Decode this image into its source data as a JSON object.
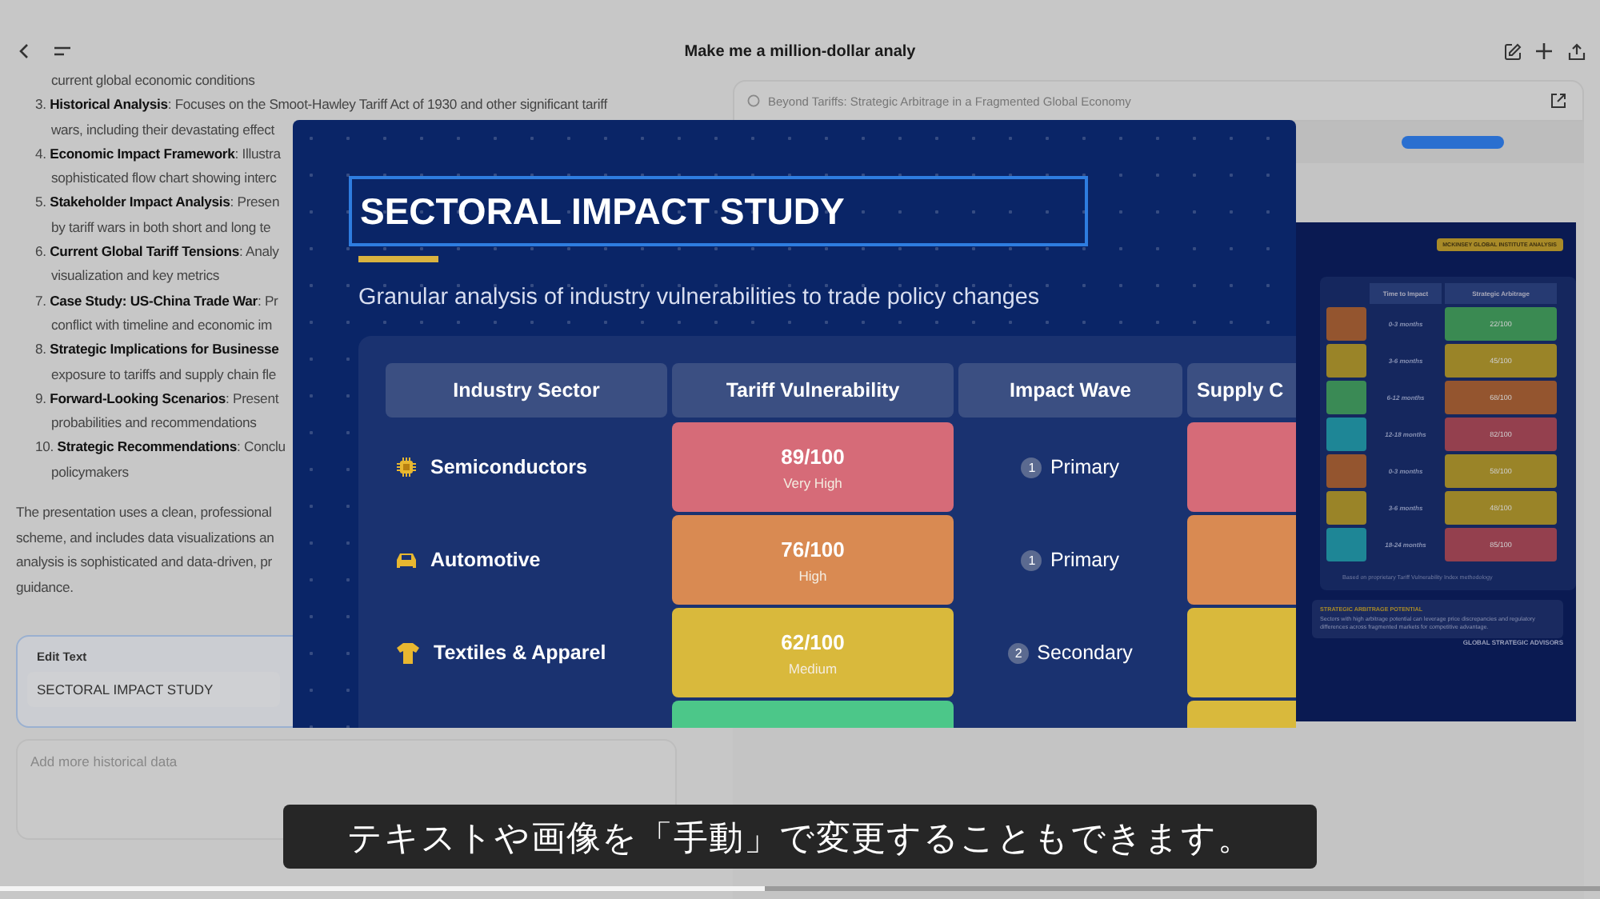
{
  "header": {
    "title": "Make me a million-dollar analy"
  },
  "chat": {
    "lines": [
      {
        "kind": "cont",
        "text": "current global economic conditions"
      },
      {
        "kind": "item",
        "text": "3. **Historical Analysis**: Focuses on the Smoot-Hawley Tariff Act of 1930 and other significant tariff"
      },
      {
        "kind": "cont",
        "text": "wars, including their devastating effect"
      },
      {
        "kind": "item",
        "text": "4. **Economic Impact Framework**: Illustra"
      },
      {
        "kind": "cont",
        "text": "sophisticated flow chart showing interc"
      },
      {
        "kind": "item",
        "text": "5. **Stakeholder Impact Analysis**: Presen"
      },
      {
        "kind": "cont",
        "text": "by tariff wars in both short and long te"
      },
      {
        "kind": "item",
        "text": "6. **Current Global Tariff Tensions**: Analy"
      },
      {
        "kind": "cont",
        "text": "visualization and key metrics"
      },
      {
        "kind": "item",
        "text": "7. **Case Study: US-China Trade War**: Pr"
      },
      {
        "kind": "cont",
        "text": "conflict with timeline and economic im"
      },
      {
        "kind": "item",
        "text": "8. **Strategic Implications for Businesse**"
      },
      {
        "kind": "cont",
        "text": "exposure to tariffs and supply chain fle"
      },
      {
        "kind": "item",
        "text": "9. **Forward-Looking Scenarios**: Present"
      },
      {
        "kind": "cont",
        "text": "probabilities and recommendations"
      },
      {
        "kind": "item",
        "text": "10. **Strategic Recommendations**: Conclu"
      },
      {
        "kind": "cont",
        "text": "policymakers"
      },
      {
        "kind": "para",
        "text": "The presentation uses a clean, professional"
      },
      {
        "kind": "para",
        "text": "scheme, and includes data visualizations an"
      },
      {
        "kind": "para",
        "text": "analysis is sophisticated and data-driven, pr"
      },
      {
        "kind": "para",
        "text": "guidance."
      }
    ]
  },
  "edit_panel": {
    "label": "Edit Text",
    "value": "SECTORAL IMPACT STUDY"
  },
  "prompt": {
    "placeholder": "Add more historical data"
  },
  "preview": {
    "tab_title": "Beyond Tariffs: Strategic Arbitrage in a Fragmented Global Economy",
    "badge": "MCKINSEY GLOBAL INSTITUTE ANALYSIS",
    "columns": [
      "Time to Impact",
      "Strategic Arbitrage"
    ],
    "rows": [
      {
        "position": {
          "color": "#94552f"
        },
        "time": "0-3 months",
        "score": "22/100",
        "color": "#3a8a52"
      },
      {
        "position": {
          "color": "#9a8428"
        },
        "time": "3-6 months",
        "score": "45/100",
        "color": "#9a8428"
      },
      {
        "position": {
          "color": "#3a8a55"
        },
        "time": "6-12 months",
        "score": "68/100",
        "color": "#94552f"
      },
      {
        "position": {
          "color": "#1e8696"
        },
        "time": "12-18 months",
        "score": "82/100",
        "color": "#94404e"
      },
      {
        "position": {
          "color": "#94552f"
        },
        "time": "0-3 months",
        "score": "58/100",
        "color": "#9a8428"
      },
      {
        "position": {
          "color": "#9a8428"
        },
        "time": "3-6 months",
        "score": "48/100",
        "color": "#9a8428"
      },
      {
        "position": {
          "color": "#1e8696"
        },
        "time": "18-24 months",
        "score": "85/100",
        "color": "#94404e"
      }
    ],
    "note": "Based on proprietary Tariff Vulnerability Index methodology",
    "callout_title": "STRATEGIC ARBITRAGE POTENTIAL",
    "callout_text": "Sectors with high arbitrage potential can leverage price discrepancies and regulatory differences across fragmented markets for competitive advantage.",
    "footer": "GLOBAL STRATEGIC ADVISORS"
  },
  "slide": {
    "title": "SECTORAL IMPACT STUDY",
    "subtitle": "Granular analysis of industry vulnerabilities to trade policy changes",
    "columns": [
      "Industry Sector",
      "Tariff Vulnerability",
      "Impact Wave",
      "Supply C"
    ],
    "rows": [
      {
        "sector": "Semiconductors",
        "score": "89/100",
        "rating": "Very High",
        "color": "#d66b78",
        "wave_number": "1",
        "wave": "Primary",
        "supply": {
          "color": "#d66b78"
        }
      },
      {
        "sector": "Automotive",
        "score": "76/100",
        "rating": "High",
        "color": "#d98a52",
        "wave_number": "1",
        "wave": "Primary",
        "supply": {
          "color": "#d98a52"
        }
      },
      {
        "sector": "Textiles & Apparel",
        "score": "62/100",
        "rating": "Medium",
        "color": "#d9b93c",
        "wave_number": "2",
        "wave": "Secondary",
        "supply": {
          "color": "#d9b93c"
        }
      },
      {
        "color": "#4cc789",
        "supply": {
          "color": "#d9b93c"
        }
      }
    ]
  },
  "caption": "テキストや画像を「手動」で変更することもできます。",
  "player": {
    "level": 0.478
  }
}
